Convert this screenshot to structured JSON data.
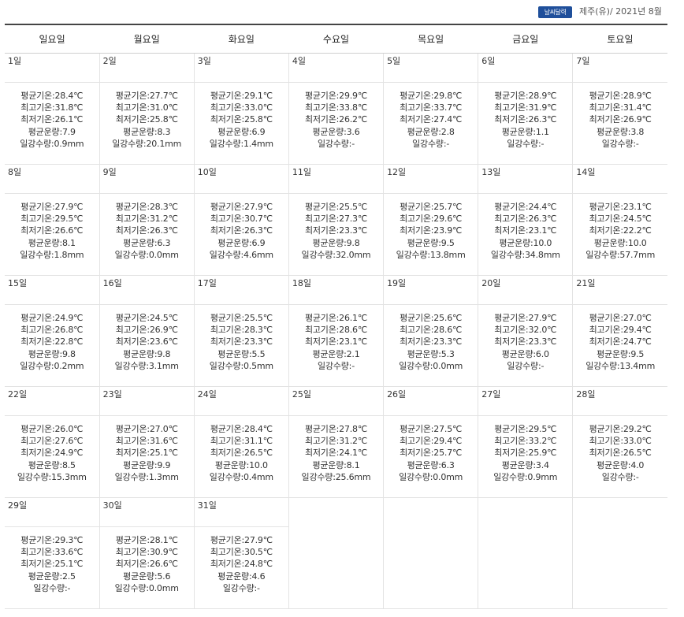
{
  "header": {
    "badge": "날씨달력",
    "place_date": "제주(유)/ 2021년 8월"
  },
  "weekdays": [
    "일요일",
    "월요일",
    "화요일",
    "수요일",
    "목요일",
    "금요일",
    "토요일"
  ],
  "labels": {
    "avg_temp": "평균기온:",
    "max_temp": "최고기온:",
    "min_temp": "최저기온:",
    "avg_cloud": "평균운량:",
    "rain": "일강수량:"
  },
  "weeks": [
    [
      {
        "day": "1일",
        "avg": "28.4℃",
        "max": "31.8℃",
        "min": "26.1℃",
        "cloud": "7.9",
        "rain": "0.9mm"
      },
      {
        "day": "2일",
        "avg": "27.7℃",
        "max": "31.0℃",
        "min": "25.8℃",
        "cloud": "8.3",
        "rain": "20.1mm"
      },
      {
        "day": "3일",
        "avg": "29.1℃",
        "max": "33.0℃",
        "min": "25.8℃",
        "cloud": "6.9",
        "rain": "1.4mm"
      },
      {
        "day": "4일",
        "avg": "29.9℃",
        "max": "33.8℃",
        "min": "26.2℃",
        "cloud": "3.6",
        "rain": "-"
      },
      {
        "day": "5일",
        "avg": "29.8℃",
        "max": "33.7℃",
        "min": "27.4℃",
        "cloud": "2.8",
        "rain": "-"
      },
      {
        "day": "6일",
        "avg": "28.9℃",
        "max": "31.9℃",
        "min": "26.3℃",
        "cloud": "1.1",
        "rain": "-"
      },
      {
        "day": "7일",
        "avg": "28.9℃",
        "max": "31.4℃",
        "min": "26.9℃",
        "cloud": "3.8",
        "rain": "-"
      }
    ],
    [
      {
        "day": "8일",
        "avg": "27.9℃",
        "max": "29.5℃",
        "min": "26.6℃",
        "cloud": "8.1",
        "rain": "1.8mm"
      },
      {
        "day": "9일",
        "avg": "28.3℃",
        "max": "31.2℃",
        "min": "26.3℃",
        "cloud": "6.3",
        "rain": "0.0mm"
      },
      {
        "day": "10일",
        "avg": "27.9℃",
        "max": "30.7℃",
        "min": "26.3℃",
        "cloud": "6.9",
        "rain": "4.6mm"
      },
      {
        "day": "11일",
        "avg": "25.5℃",
        "max": "27.3℃",
        "min": "23.3℃",
        "cloud": "9.8",
        "rain": "32.0mm"
      },
      {
        "day": "12일",
        "avg": "25.7℃",
        "max": "29.6℃",
        "min": "23.9℃",
        "cloud": "9.5",
        "rain": "13.8mm"
      },
      {
        "day": "13일",
        "avg": "24.4℃",
        "max": "26.3℃",
        "min": "23.1℃",
        "cloud": "10.0",
        "rain": "34.8mm"
      },
      {
        "day": "14일",
        "avg": "23.1℃",
        "max": "24.5℃",
        "min": "22.2℃",
        "cloud": "10.0",
        "rain": "57.7mm"
      }
    ],
    [
      {
        "day": "15일",
        "avg": "24.9℃",
        "max": "26.8℃",
        "min": "22.8℃",
        "cloud": "9.8",
        "rain": "0.2mm"
      },
      {
        "day": "16일",
        "avg": "24.5℃",
        "max": "26.9℃",
        "min": "23.6℃",
        "cloud": "9.8",
        "rain": "3.1mm"
      },
      {
        "day": "17일",
        "avg": "25.5℃",
        "max": "28.3℃",
        "min": "23.3℃",
        "cloud": "5.5",
        "rain": "0.5mm"
      },
      {
        "day": "18일",
        "avg": "26.1℃",
        "max": "28.6℃",
        "min": "23.1℃",
        "cloud": "2.1",
        "rain": "-"
      },
      {
        "day": "19일",
        "avg": "25.6℃",
        "max": "28.6℃",
        "min": "23.3℃",
        "cloud": "5.3",
        "rain": "0.0mm"
      },
      {
        "day": "20일",
        "avg": "27.9℃",
        "max": "32.0℃",
        "min": "23.3℃",
        "cloud": "6.0",
        "rain": "-"
      },
      {
        "day": "21일",
        "avg": "27.0℃",
        "max": "29.4℃",
        "min": "24.7℃",
        "cloud": "9.5",
        "rain": "13.4mm"
      }
    ],
    [
      {
        "day": "22일",
        "avg": "26.0℃",
        "max": "27.6℃",
        "min": "24.9℃",
        "cloud": "8.5",
        "rain": "15.3mm"
      },
      {
        "day": "23일",
        "avg": "27.0℃",
        "max": "31.6℃",
        "min": "25.1℃",
        "cloud": "9.9",
        "rain": "1.3mm"
      },
      {
        "day": "24일",
        "avg": "28.4℃",
        "max": "31.1℃",
        "min": "26.5℃",
        "cloud": "10.0",
        "rain": "0.4mm"
      },
      {
        "day": "25일",
        "avg": "27.8℃",
        "max": "31.2℃",
        "min": "24.1℃",
        "cloud": "8.1",
        "rain": "25.6mm"
      },
      {
        "day": "26일",
        "avg": "27.5℃",
        "max": "29.4℃",
        "min": "25.7℃",
        "cloud": "6.3",
        "rain": "0.0mm"
      },
      {
        "day": "27일",
        "avg": "29.5℃",
        "max": "33.2℃",
        "min": "25.9℃",
        "cloud": "3.4",
        "rain": "0.9mm"
      },
      {
        "day": "28일",
        "avg": "29.2℃",
        "max": "33.0℃",
        "min": "26.5℃",
        "cloud": "4.0",
        "rain": "-"
      }
    ],
    [
      {
        "day": "29일",
        "avg": "29.3℃",
        "max": "33.6℃",
        "min": "25.1℃",
        "cloud": "2.5",
        "rain": "-"
      },
      {
        "day": "30일",
        "avg": "28.1℃",
        "max": "30.9℃",
        "min": "26.6℃",
        "cloud": "5.6",
        "rain": "0.0mm"
      },
      {
        "day": "31일",
        "avg": "27.9℃",
        "max": "30.5℃",
        "min": "24.8℃",
        "cloud": "4.6",
        "rain": "-"
      },
      null,
      null,
      null,
      null
    ]
  ]
}
